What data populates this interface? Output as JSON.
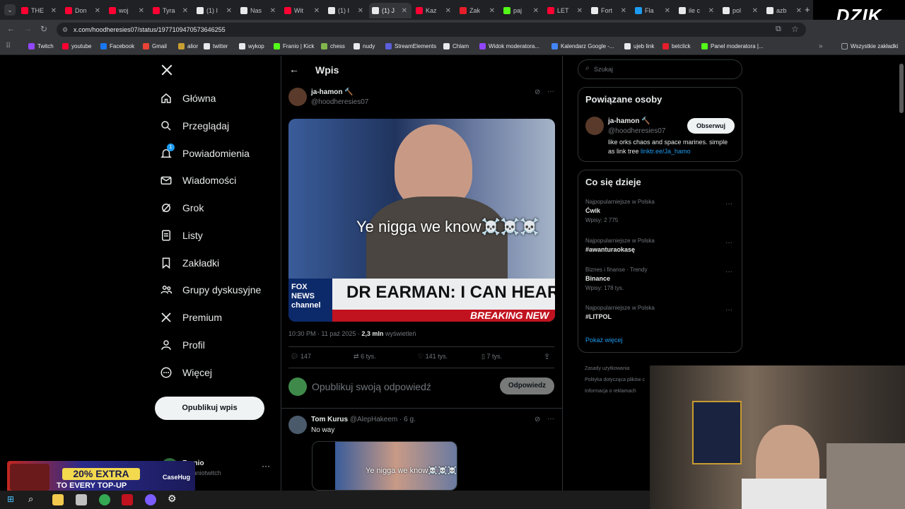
{
  "browser": {
    "tabs": [
      {
        "label": "THE",
        "fav": "#ff0033"
      },
      {
        "label": "Don",
        "fav": "#ff0033"
      },
      {
        "label": "woj",
        "fav": "#ff0033"
      },
      {
        "label": "Tyra",
        "fav": "#ff0033"
      },
      {
        "label": "(1) I",
        "fav": "#e7e9ea"
      },
      {
        "label": "Nas",
        "fav": "#e7e9ea"
      },
      {
        "label": "Wit",
        "fav": "#ff0033"
      },
      {
        "label": "(1) I",
        "fav": "#e7e9ea"
      },
      {
        "label": "(1) J",
        "fav": "#e7e9ea"
      },
      {
        "label": "Kaz",
        "fav": "#ff0033"
      },
      {
        "label": "Zak",
        "fav": "#e51e2a"
      },
      {
        "label": "paj",
        "fav": "#53fc18"
      },
      {
        "label": "LET",
        "fav": "#ff0033"
      },
      {
        "label": "Fort",
        "fav": "#e7e9ea"
      },
      {
        "label": "Fla",
        "fav": "#1d9bf0"
      },
      {
        "label": "ile c",
        "fav": "#e7e9ea"
      },
      {
        "label": "pol",
        "fav": "#e7e9ea"
      },
      {
        "label": "azb",
        "fav": "#e7e9ea"
      }
    ],
    "url": "x.com/hoodheresies07/status/1977109470573646255",
    "bookmarks": [
      {
        "label": "Twitch",
        "color": "#9146ff"
      },
      {
        "label": "youtube",
        "color": "#ff0033"
      },
      {
        "label": "Facebook",
        "color": "#1877f2"
      },
      {
        "label": "Gmail",
        "color": "#ea4335"
      },
      {
        "label": "alior",
        "color": "#c8a032"
      },
      {
        "label": "twitter",
        "color": "#e7e9ea"
      },
      {
        "label": "wykop",
        "color": "#e7e9ea"
      },
      {
        "label": "Franio | Kick",
        "color": "#53fc18"
      },
      {
        "label": "chess",
        "color": "#81b64c"
      },
      {
        "label": "nudy",
        "color": "#e8eaed"
      },
      {
        "label": "StreamElements",
        "color": "#5b5fdd"
      },
      {
        "label": "Chlam",
        "color": "#e8eaed"
      },
      {
        "label": "Widok moderatora...",
        "color": "#9146ff"
      },
      {
        "label": "Kalendarz Google -...",
        "color": "#4285f4"
      },
      {
        "label": "ujeb link",
        "color": "#e8eaed"
      },
      {
        "label": "betclick",
        "color": "#e51e2a"
      },
      {
        "label": "Panel moderatora |...",
        "color": "#53fc18"
      }
    ],
    "all_bookmarks": "Wszystkie zakładki",
    "brand": "DZIK"
  },
  "nav": {
    "items": [
      {
        "label": "Główna",
        "icon": "home-icon"
      },
      {
        "label": "Przeglądaj",
        "icon": "search-icon"
      },
      {
        "label": "Powiadomienia",
        "icon": "bell-icon"
      },
      {
        "label": "Wiadomości",
        "icon": "mail-icon"
      },
      {
        "label": "Grok",
        "icon": "grok-icon"
      },
      {
        "label": "Listy",
        "icon": "list-icon"
      },
      {
        "label": "Zakładki",
        "icon": "bookmark-icon"
      },
      {
        "label": "Grupy dyskusyjne",
        "icon": "people-icon"
      },
      {
        "label": "Premium",
        "icon": "x-logo-icon"
      },
      {
        "label": "Profil",
        "icon": "person-icon"
      },
      {
        "label": "Więcej",
        "icon": "more-icon"
      }
    ],
    "notif_badge": "1",
    "post_button": "Opublikuj wpis",
    "account_name": "Franio",
    "account_handle": "@franiotwitch"
  },
  "post": {
    "header": "Wpis",
    "author_name": "ja-hamon 🔨",
    "author_handle": "@hoodheresies07",
    "media_caption": "Ye nigga we know☠️☠️☠️",
    "media_lower_third": "DR EARMAN: I CAN HEAR YOU",
    "media_breaking": "BREAKING NEW",
    "media_channel": "FOX NEWS channel",
    "timestamp": "10:30 PM · 11 paź 2025 · ",
    "views_count": "2,3 mln",
    "views_label": " wyświetleń",
    "replies": "147",
    "reposts": "6 tys.",
    "likes": "141 tys.",
    "bookmarks": "7 tys.",
    "reply_placeholder": "Opublikuj swoją odpowiedź",
    "reply_button": "Odpowiedz"
  },
  "reply": {
    "name": "Tom Kurus",
    "handle": "@AlepHakeem · 6 g.",
    "text": "No way",
    "media_caption": "Ye nigga we know☠️☠️☠️"
  },
  "sidebar": {
    "search_placeholder": "Szukaj",
    "related_title": "Powiązane osoby",
    "related_name": "ja-hamon 🔨",
    "related_handle": "@hoodheresies07",
    "related_bio": "like orks chaos and space marines. simple as link tree ",
    "related_link": "linktr.ee/Ja_hamo",
    "follow_button": "Obserwuj",
    "trends_title": "Co się dzieje",
    "trends": [
      {
        "category": "Najpopularniejsze w Polska",
        "name": "Ćwik",
        "count": "Wpisy: 2 775"
      },
      {
        "category": "Najpopularniejsze w Polska",
        "name": "#awanturaokasę",
        "count": ""
      },
      {
        "category": "Biznes i finanse · Trendy",
        "name": "Binance",
        "count": "Wpisy: 178 tys."
      },
      {
        "category": "Najpopularniejsze w Polska",
        "name": "#LITPOL",
        "count": ""
      }
    ],
    "show_more": "Pokaż więcej",
    "footer_lines": [
      "Zasady użytkowania",
      "Polityka dotycząca plików c",
      "Informacja o reklamach"
    ]
  },
  "overlay": {
    "promo_line1": "20% EXTRA",
    "promo_line2": "TO EVERY TOP-UP",
    "promo_brand": "CaseHug"
  },
  "colors": {
    "accent": "#1d9bf0",
    "bg": "#000000",
    "border": "#2f3336"
  }
}
